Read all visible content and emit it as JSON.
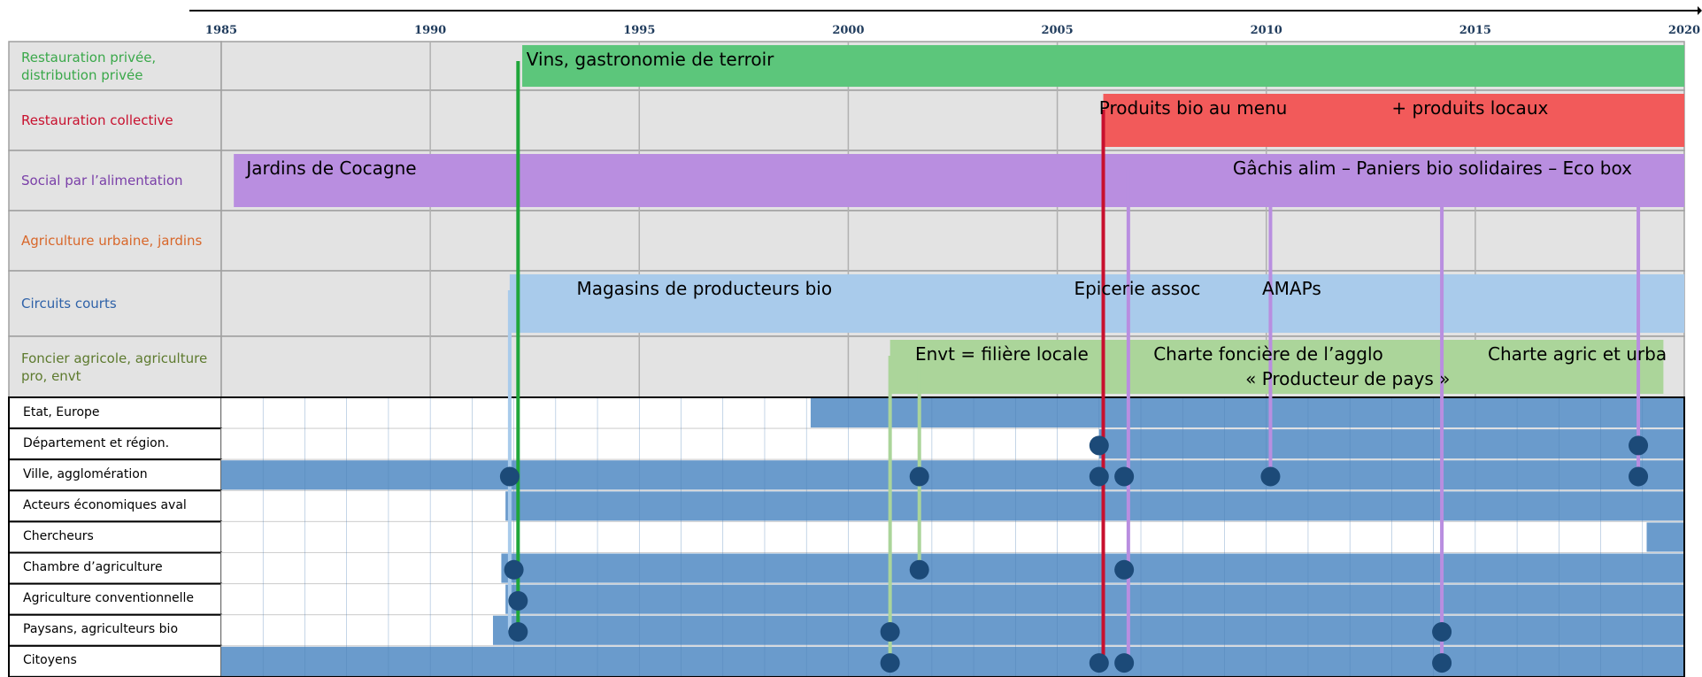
{
  "timeline": {
    "start_year": 1985,
    "end_year": 2020,
    "year_labels": [
      {
        "year": 1985,
        "label": "1985"
      },
      {
        "year": 1990,
        "label": "1990"
      },
      {
        "year": 1995,
        "label": "1995"
      },
      {
        "year": 2000,
        "label": "2000"
      },
      {
        "year": 2005,
        "label": "2005"
      },
      {
        "year": 2010,
        "label": "2010"
      },
      {
        "year": 2015,
        "label": "2015"
      },
      {
        "year": 2020,
        "label": "2020"
      }
    ]
  },
  "domains": [
    {
      "id": "restauration-privee",
      "label": "Restauration privée, distribution privée",
      "color": "#3aa84a"
    },
    {
      "id": "restauration-collective",
      "label": "Restauration collective",
      "color": "#c8102e"
    },
    {
      "id": "social",
      "label": "Social par l’alimentation",
      "color": "#7a3fa8"
    },
    {
      "id": "agriculture-urbaine",
      "label": "Agriculture urbaine, jardins",
      "color": "#d8672a"
    },
    {
      "id": "circuits-courts",
      "label": "Circuits courts",
      "color": "#2f62a8"
    },
    {
      "id": "foncier",
      "label": "Foncier agricole, agriculture pro, envt",
      "color": "#5d7a2e"
    }
  ],
  "bands": [
    {
      "domain": 0,
      "start": 1992.2,
      "end": 2020,
      "color": "#5cc67b"
    },
    {
      "domain": 1,
      "start": 2006.1,
      "end": 2020,
      "color": "#f25a5a"
    },
    {
      "domain": 2,
      "start": 1985.3,
      "end": 2020,
      "color": "#b98ee0"
    },
    {
      "domain": 4,
      "start": 1991.9,
      "end": 2020,
      "color": "#a9cbeb"
    },
    {
      "domain": 5,
      "start": 2001.0,
      "end": 2019.5,
      "color": "#abd59a"
    }
  ],
  "band_texts": [
    {
      "domain": 0,
      "year": 1992.3,
      "line": 0,
      "text": "Vins, gastronomie de terroir"
    },
    {
      "domain": 1,
      "year": 2006.0,
      "line": 0,
      "text": "Produits bio au menu"
    },
    {
      "domain": 1,
      "year": 2013.0,
      "line": 0,
      "text": "+ produits locaux"
    },
    {
      "domain": 2,
      "year": 1985.6,
      "line": 0,
      "text": "Jardins de Cocagne"
    },
    {
      "domain": 2,
      "year": 2009.2,
      "line": 0,
      "text": "Gâchis alim – Paniers bio solidaires – Eco box"
    },
    {
      "domain": 4,
      "year": 1993.5,
      "line": 0,
      "text": "Magasins de producteurs bio"
    },
    {
      "domain": 4,
      "year": 2005.4,
      "line": 0,
      "text": "Epicerie assoc"
    },
    {
      "domain": 4,
      "year": 2009.9,
      "line": 0,
      "text": "AMAPs"
    },
    {
      "domain": 5,
      "year": 2001.6,
      "line": 0,
      "text": "Envt = filière locale"
    },
    {
      "domain": 5,
      "year": 2007.3,
      "line": 0,
      "text": "Charte foncière de l’agglo"
    },
    {
      "domain": 5,
      "year": 2009.5,
      "line": 1,
      "text": "« Producteur de pays »"
    },
    {
      "domain": 5,
      "year": 2015.3,
      "line": 0,
      "text": "Charte agric et urba"
    }
  ],
  "actors": [
    {
      "label": "Etat, Europe",
      "segments": [
        [
          1999.1,
          2020
        ]
      ]
    },
    {
      "label": "Département et région.",
      "segments": [
        [
          2006.0,
          2020
        ]
      ]
    },
    {
      "label": "Ville, agglomération",
      "segments": [
        [
          1985,
          2020
        ]
      ]
    },
    {
      "label": "Acteurs économiques aval",
      "segments": [
        [
          1991.8,
          2020
        ]
      ]
    },
    {
      "label": "Chercheurs",
      "segments": [
        [
          2019.1,
          2020
        ]
      ]
    },
    {
      "label": "Chambre d’agriculture",
      "segments": [
        [
          1991.7,
          2020
        ]
      ]
    },
    {
      "label": "Agriculture conventionnelle",
      "segments": [
        [
          1991.8,
          2020
        ]
      ]
    },
    {
      "label": "Paysans, agriculteurs bio",
      "segments": [
        [
          1991.5,
          2020
        ]
      ]
    },
    {
      "label": "Citoyens",
      "segments": [
        [
          1985,
          2020
        ]
      ]
    }
  ],
  "connectors": [
    {
      "year": 1991.9,
      "color": "#a9cbeb",
      "from_domain": 4,
      "to_actor": 7
    },
    {
      "year": 1992.1,
      "color": "#1fa63a",
      "from_domain": 0,
      "to_actor": 7
    },
    {
      "year": 2001.0,
      "color": "#abd59a",
      "from_domain": 5,
      "to_actor": 8
    },
    {
      "year": 2001.7,
      "color": "#abd59a",
      "from_domain": 5,
      "to_actor": 5
    },
    {
      "year": 2006.1,
      "color": "#c8102e",
      "from_domain": 1,
      "to_actor": 8
    },
    {
      "year": 2006.7,
      "color": "#b98ee0",
      "from_domain": 2,
      "to_actor": 8
    },
    {
      "year": 2010.1,
      "color": "#b98ee0",
      "from_domain": 2,
      "to_actor": 2
    },
    {
      "year": 2014.2,
      "color": "#b98ee0",
      "from_domain": 2,
      "to_actor": 8
    },
    {
      "year": 2018.9,
      "color": "#b98ee0",
      "from_domain": 2,
      "to_actor": 2
    }
  ],
  "dots": [
    {
      "year": 1991.9,
      "actor": 2
    },
    {
      "year": 1992.0,
      "actor": 5
    },
    {
      "year": 1992.1,
      "actor": 6
    },
    {
      "year": 1992.1,
      "actor": 7
    },
    {
      "year": 2001.7,
      "actor": 2
    },
    {
      "year": 2001.7,
      "actor": 5
    },
    {
      "year": 2001.0,
      "actor": 7
    },
    {
      "year": 2001.0,
      "actor": 8
    },
    {
      "year": 2006.0,
      "actor": 1
    },
    {
      "year": 2006.0,
      "actor": 2
    },
    {
      "year": 2006.0,
      "actor": 8
    },
    {
      "year": 2006.6,
      "actor": 2
    },
    {
      "year": 2006.6,
      "actor": 5
    },
    {
      "year": 2006.6,
      "actor": 8
    },
    {
      "year": 2010.1,
      "actor": 2
    },
    {
      "year": 2014.2,
      "actor": 7
    },
    {
      "year": 2014.2,
      "actor": 8
    },
    {
      "year": 2018.9,
      "actor": 1
    },
    {
      "year": 2018.9,
      "actor": 2
    }
  ],
  "colors": {
    "domain_background": "#e3e3e3",
    "grid_line": "#b0b0b0",
    "actor_fill": "#6a9bcc",
    "actor_grid": "#4f80b6",
    "dot_fill": "#1c4a78",
    "border": "#000000"
  }
}
